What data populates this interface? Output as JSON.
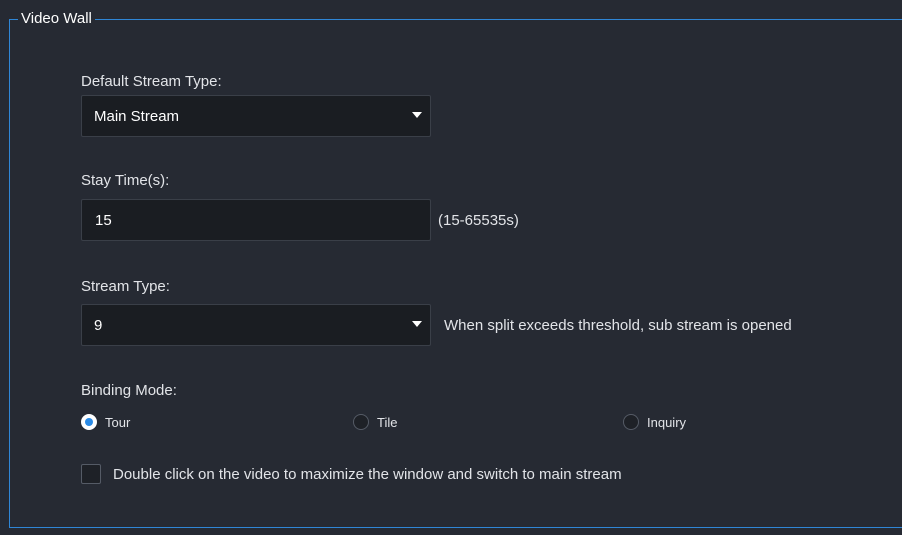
{
  "group": {
    "title": "Video Wall"
  },
  "default_stream_type": {
    "label": "Default Stream Type:",
    "value": "Main Stream"
  },
  "stay_time": {
    "label": "Stay Time(s):",
    "value": "15",
    "range_hint": "(15-65535s)"
  },
  "stream_type": {
    "label": "Stream Type:",
    "value": "9",
    "hint": "When split exceeds threshold, sub stream is opened"
  },
  "binding_mode": {
    "label": "Binding Mode:",
    "options": [
      {
        "label": "Tour",
        "checked": true
      },
      {
        "label": "Tile",
        "checked": false
      },
      {
        "label": "Inquiry",
        "checked": false
      }
    ]
  },
  "double_click": {
    "label": "Double click on the video to maximize the window and switch to main stream",
    "checked": false
  },
  "colors": {
    "background": "#262a33",
    "accent": "#2b8be6",
    "border": "#2f86d6",
    "input_bg": "#1a1d22"
  }
}
